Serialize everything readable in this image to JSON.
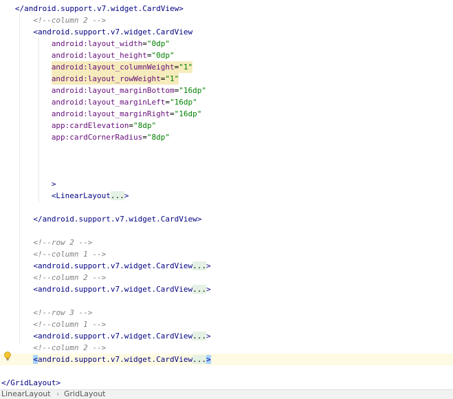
{
  "editor": {
    "lines": [
      {
        "indent": 3,
        "tokens": [
          {
            "t": "tag",
            "v": "</android.support.v7.widget.CardView>"
          }
        ]
      },
      {
        "indent": 7,
        "tokens": [
          {
            "t": "comment",
            "v": "<!--column 2 -->"
          }
        ]
      },
      {
        "indent": 7,
        "tokens": [
          {
            "t": "tag",
            "v": "<android.support.v7.widget.CardView"
          }
        ]
      },
      {
        "indent": 11,
        "tokens": [
          {
            "t": "attr",
            "v": "android:layout_width"
          },
          {
            "t": "eq",
            "v": "="
          },
          {
            "t": "val",
            "v": "\"0dp\""
          }
        ]
      },
      {
        "indent": 11,
        "tokens": [
          {
            "t": "attr",
            "v": "android:layout_height"
          },
          {
            "t": "eq",
            "v": "="
          },
          {
            "t": "val",
            "v": "\"0dp\""
          }
        ]
      },
      {
        "indent": 11,
        "hl": true,
        "tokens": [
          {
            "t": "attr",
            "v": "android:layout_columnWeight"
          },
          {
            "t": "eq",
            "v": "="
          },
          {
            "t": "val",
            "v": "\"1\""
          }
        ]
      },
      {
        "indent": 11,
        "hl": true,
        "tokens": [
          {
            "t": "attr",
            "v": "android:layout_rowWeight"
          },
          {
            "t": "eq",
            "v": "="
          },
          {
            "t": "val",
            "v": "\"1\""
          }
        ]
      },
      {
        "indent": 11,
        "tokens": [
          {
            "t": "attr",
            "v": "android:layout_marginBottom"
          },
          {
            "t": "eq",
            "v": "="
          },
          {
            "t": "val",
            "v": "\"16dp\""
          }
        ]
      },
      {
        "indent": 11,
        "tokens": [
          {
            "t": "attr",
            "v": "android:layout_marginLeft"
          },
          {
            "t": "eq",
            "v": "="
          },
          {
            "t": "val",
            "v": "\"16dp\""
          }
        ]
      },
      {
        "indent": 11,
        "tokens": [
          {
            "t": "attr",
            "v": "android:layout_marginRight"
          },
          {
            "t": "eq",
            "v": "="
          },
          {
            "t": "val",
            "v": "\"16dp\""
          }
        ]
      },
      {
        "indent": 11,
        "tokens": [
          {
            "t": "attr",
            "v": "app:cardElevation"
          },
          {
            "t": "eq",
            "v": "="
          },
          {
            "t": "val",
            "v": "\"8dp\""
          }
        ]
      },
      {
        "indent": 11,
        "tokens": [
          {
            "t": "attr",
            "v": "app:cardCornerRadius"
          },
          {
            "t": "eq",
            "v": "="
          },
          {
            "t": "val",
            "v": "\"8dp\""
          }
        ]
      },
      {
        "indent": 0,
        "tokens": []
      },
      {
        "indent": 0,
        "tokens": []
      },
      {
        "indent": 0,
        "tokens": []
      },
      {
        "indent": 11,
        "tokens": [
          {
            "t": "tag",
            "v": ">"
          }
        ]
      },
      {
        "indent": 11,
        "tokens": [
          {
            "t": "tag",
            "v": "<LinearLayout"
          },
          {
            "t": "dots",
            "v": "..."
          },
          {
            "t": "tag",
            "v": ">"
          }
        ]
      },
      {
        "indent": 0,
        "tokens": []
      },
      {
        "indent": 7,
        "tokens": [
          {
            "t": "tag",
            "v": "</android.support.v7.widget.CardView>"
          }
        ]
      },
      {
        "indent": 0,
        "tokens": []
      },
      {
        "indent": 7,
        "tokens": [
          {
            "t": "comment",
            "v": "<!--row 2 -->"
          }
        ]
      },
      {
        "indent": 7,
        "tokens": [
          {
            "t": "comment",
            "v": "<!--column 1 -->"
          }
        ]
      },
      {
        "indent": 7,
        "tokens": [
          {
            "t": "tag",
            "v": "<android.support.v7.widget.CardView"
          },
          {
            "t": "dots",
            "v": "..."
          },
          {
            "t": "tag",
            "v": ">"
          }
        ]
      },
      {
        "indent": 7,
        "tokens": [
          {
            "t": "comment",
            "v": "<!--column 2 -->"
          }
        ]
      },
      {
        "indent": 7,
        "tokens": [
          {
            "t": "tag",
            "v": "<android.support.v7.widget.CardView"
          },
          {
            "t": "dots",
            "v": "..."
          },
          {
            "t": "tag",
            "v": ">"
          }
        ]
      },
      {
        "indent": 0,
        "tokens": []
      },
      {
        "indent": 7,
        "tokens": [
          {
            "t": "comment",
            "v": "<!--row 3 -->"
          }
        ]
      },
      {
        "indent": 7,
        "tokens": [
          {
            "t": "comment",
            "v": "<!--column 1 -->"
          }
        ]
      },
      {
        "indent": 7,
        "tokens": [
          {
            "t": "tag",
            "v": "<android.support.v7.widget.CardView"
          },
          {
            "t": "dots",
            "v": "..."
          },
          {
            "t": "tag",
            "v": ">"
          }
        ]
      },
      {
        "indent": 7,
        "tokens": [
          {
            "t": "comment",
            "v": "<!--column 2 -->"
          }
        ]
      },
      {
        "indent": 7,
        "current": true,
        "tokens": [
          {
            "t": "caret",
            "v": "<"
          },
          {
            "t": "tag",
            "v": "android.support.v7.widget.CardView"
          },
          {
            "t": "dots",
            "v": "..."
          },
          {
            "t": "caret",
            "v": ">"
          }
        ]
      },
      {
        "indent": 0,
        "tokens": []
      },
      {
        "indent": 0,
        "tokens": [
          {
            "t": "tag",
            "v": "</GridLayout>"
          }
        ]
      }
    ]
  },
  "breadcrumb": {
    "items": [
      "LinearLayout",
      "GridLayout"
    ],
    "separator": "›"
  },
  "icons": {
    "gutter": "lightbulb-icon"
  },
  "colors": {
    "tag": "#000080",
    "attribute": "#660e7a",
    "value": "#008000",
    "comment": "#808080",
    "current_line": "#fffae3",
    "fold_placeholder": "#e4f1e4",
    "highlight": "#f6ebbc",
    "brace_match": "#a6d2ff"
  }
}
